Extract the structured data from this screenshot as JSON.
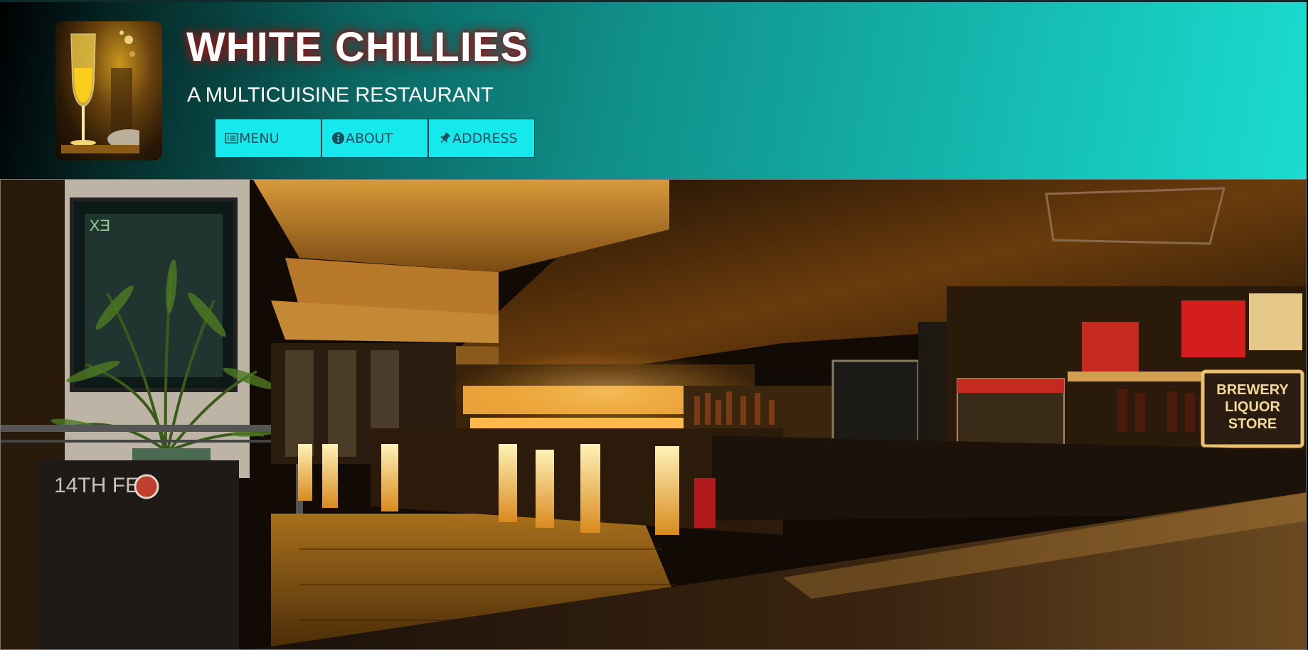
{
  "header": {
    "title": "WHITE CHILLIES",
    "subtitle": "A MULTICUISINE RESTAURANT",
    "logo_icon": "wine-glass-icon",
    "colors": {
      "gradient_start": "#000000",
      "gradient_end": "#1bdccf",
      "nav_button": "#15e9eb",
      "nav_text": "#1d4d5a",
      "title_glow": "#a02020"
    }
  },
  "nav": {
    "items": [
      {
        "label": "MENU",
        "icon": "list-icon"
      },
      {
        "label": "ABOUT",
        "icon": "info-icon"
      },
      {
        "label": "ADDRESS",
        "icon": "pin-icon"
      }
    ]
  },
  "hero": {
    "description_icon": "restaurant-interior-photo",
    "sign_text": "BREWERY\nLIQUOR\nSTORE",
    "chalkboard_text": "14TH FEB",
    "exit_sign": "EX"
  }
}
